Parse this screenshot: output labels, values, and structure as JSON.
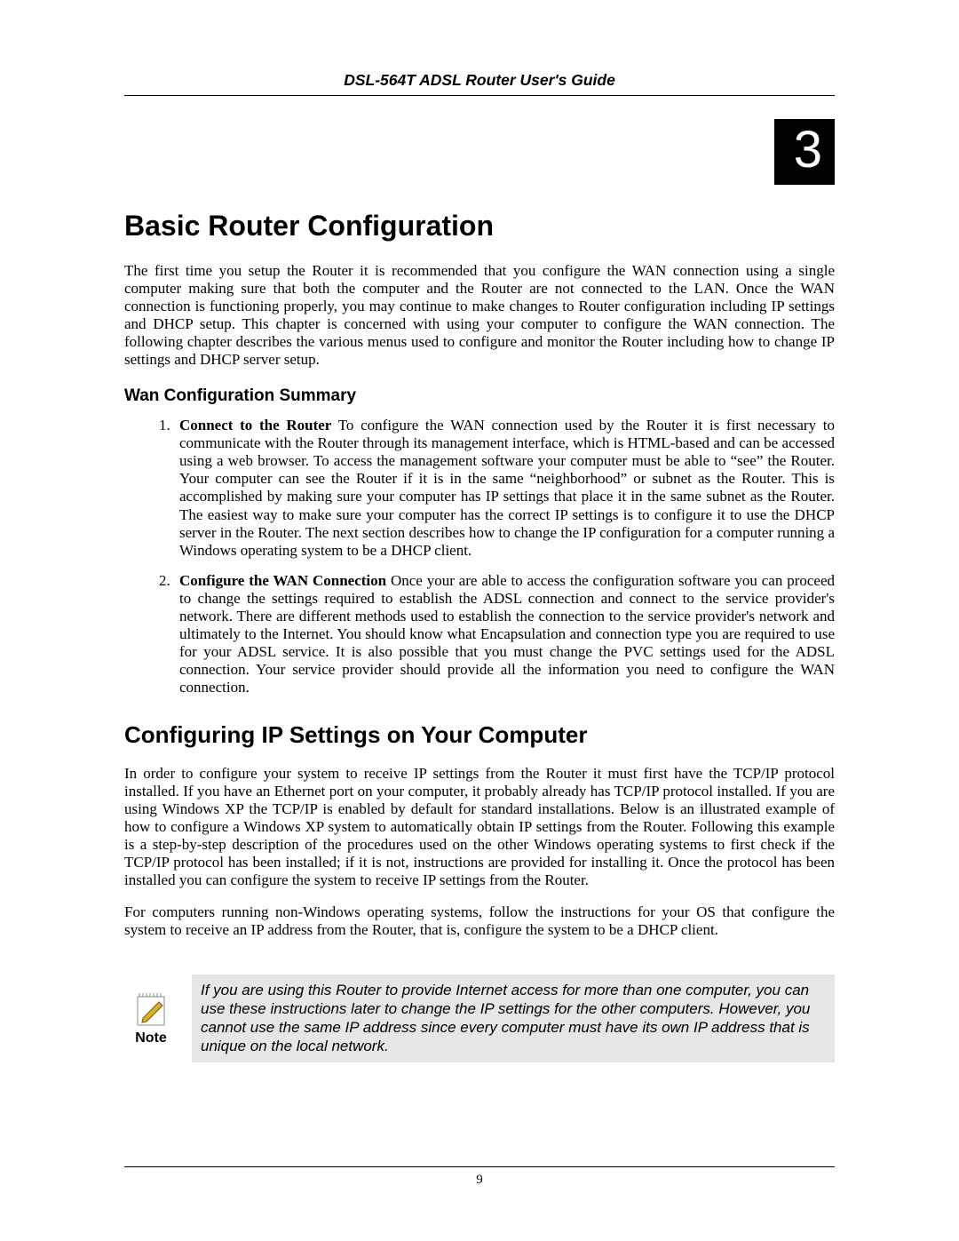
{
  "header": {
    "running_title": "DSL-564T ADSL Router User's Guide"
  },
  "chapter_number": "3",
  "title": "Basic Router Configuration",
  "intro_paragraph": "The first time you setup the Router it is recommended that you configure the WAN connection using a single computer making sure that both the computer and the Router are not connected to the LAN. Once the WAN connection is functioning properly, you may continue to make changes to Router configuration including IP settings and DHCP setup. This chapter is concerned with using your computer to configure the WAN connection. The following chapter describes the various menus used to configure and monitor the Router including how to change IP settings and DHCP server setup.",
  "wan_summary": {
    "heading": "Wan Configuration Summary",
    "items": [
      {
        "lead": "Connect to the Router",
        "text": " To configure the WAN connection used by the Router it is first necessary to communicate with the Router through its management interface, which is HTML-based and can be accessed using a web browser. To access the management software your computer must be able to “see” the Router. Your computer can see the Router if it is in the same “neighborhood” or subnet as the Router. This is accomplished by making sure your computer has IP settings that place it in the same subnet as the Router. The easiest way to make sure your computer has the correct IP settings is to configure it to use the DHCP server in the Router. The next section describes how to change the IP configuration for a computer running a Windows operating system to be a DHCP client."
      },
      {
        "lead": "Configure the WAN Connection",
        "text": " Once your are able to access the configuration software you can proceed to change the settings required to establish the ADSL connection and connect to the service provider's network. There are different methods used to establish the connection to the service provider's network and ultimately to the Internet. You should know what Encapsulation and connection type you are required to use for your ADSL service. It is also possible that you must change the PVC settings used for the ADSL connection. Your service provider should provide all the information you need to configure the WAN connection."
      }
    ]
  },
  "ip_section": {
    "heading": "Configuring IP Settings on Your Computer",
    "para1": "In order to configure your system to receive IP settings from the Router it must first have the TCP/IP protocol installed. If you have an Ethernet port on your computer, it probably already has TCP/IP protocol installed. If you are using Windows XP the TCP/IP is enabled by default for standard installations. Below is an illustrated example of how to configure a Windows XP system to automatically obtain IP settings from the Router. Following this example is a step-by-step description of the procedures used on the other Windows operating systems to first check if the TCP/IP protocol has been installed; if it is not, instructions are provided for installing it. Once the protocol has been installed you can configure the system to receive IP settings from the Router.",
    "para2": "For computers running non-Windows operating systems, follow the instructions for your OS that configure the system to receive an IP address from the Router, that is, configure the system to be a DHCP client."
  },
  "note": {
    "label": "Note",
    "text": "If you are using this Router to provide Internet access for more than one computer, you can use these instructions later to change the IP settings for the other computers. However, you cannot use the same IP address since every computer must have its own IP address that is unique on the local network."
  },
  "footer": {
    "page_number": "9"
  }
}
